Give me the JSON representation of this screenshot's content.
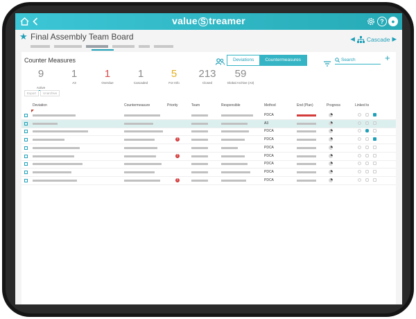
{
  "app": {
    "logo_left": "value",
    "logo_s": "S",
    "logo_right": "treamer",
    "help_label": "?",
    "user_label": "●"
  },
  "board": {
    "title": "Final Assembly Team Board",
    "cascade_label": "Cascade"
  },
  "panel": {
    "title": "Counter Measures",
    "toggle": {
      "deviations": "Deviations",
      "countermeasures": "Countermeasures"
    },
    "search_placeholder": "Search",
    "actions": {
      "export": "Export",
      "unarchive": "Unarchive"
    }
  },
  "stats": [
    {
      "value": "9",
      "label": "Active",
      "color": "#8a8a8a"
    },
    {
      "value": "1",
      "label": "A3",
      "color": "#8a8a8a"
    },
    {
      "value": "1",
      "label": "Overdue",
      "color": "#d94c4c"
    },
    {
      "value": "1",
      "label": "Cascaded",
      "color": "#8a8a8a"
    },
    {
      "value": "5",
      "label": "For Info",
      "color": "#e0b020"
    },
    {
      "value": "213",
      "label": "Closed",
      "color": "#8a8a8a"
    },
    {
      "value": "59",
      "label": "Global Archive (A3)",
      "color": "#8a8a8a"
    }
  ],
  "columns": {
    "deviation": "Deviation",
    "countermeasure": "Countermeasure",
    "priority": "Priority",
    "team": "Team",
    "responsible": "Responsible",
    "method": "Method",
    "end_plan": "End (Plan)",
    "progress": "Progress",
    "linked_to": "Linked to"
  },
  "rows": [
    {
      "method": "PDCA",
      "priority": false,
      "selected": false,
      "overdue": true,
      "flag": true,
      "link": false,
      "cup": true
    },
    {
      "method": "A3",
      "priority": false,
      "selected": true,
      "overdue": false,
      "flag": false,
      "link": false,
      "cup": false
    },
    {
      "method": "PDCA",
      "priority": false,
      "selected": false,
      "overdue": false,
      "flag": false,
      "link": true,
      "cup": false
    },
    {
      "method": "PDCA",
      "priority": true,
      "selected": false,
      "overdue": false,
      "flag": false,
      "link": false,
      "cup": true
    },
    {
      "method": "PDCA",
      "priority": false,
      "selected": false,
      "overdue": false,
      "flag": false,
      "link": false,
      "cup": false
    },
    {
      "method": "PDCA",
      "priority": true,
      "selected": false,
      "overdue": false,
      "flag": false,
      "link": false,
      "cup": false
    },
    {
      "method": "PDCA",
      "priority": false,
      "selected": false,
      "overdue": false,
      "flag": false,
      "link": false,
      "cup": false
    },
    {
      "method": "PDCA",
      "priority": false,
      "selected": false,
      "overdue": false,
      "flag": false,
      "link": false,
      "cup": false
    },
    {
      "method": "PDCA",
      "priority": true,
      "selected": false,
      "overdue": false,
      "flag": false,
      "link": false,
      "cup": false
    }
  ],
  "colors": {
    "accent": "#1f9fb8",
    "topbar": "#34b4c4",
    "priority": "#d43b3b",
    "overdue": "#d43b3b",
    "selected_row": "#dcefef"
  }
}
